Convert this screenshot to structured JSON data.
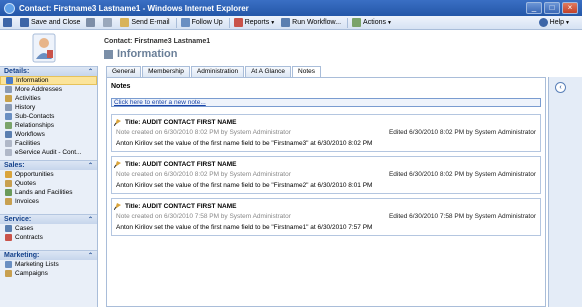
{
  "window": {
    "title": "Contact: Firstname3 Lastname1 - Windows Internet Explorer",
    "buttons": [
      "_",
      "□",
      "×"
    ]
  },
  "toolbar": {
    "save_and_close": "Save and Close",
    "send_email": "Send E-mail",
    "follow_up": "Follow Up",
    "reports": "Reports",
    "run_workflow": "Run Workflow...",
    "actions": "Actions",
    "help": "Help"
  },
  "header": {
    "entity": "Contact: Firstname3 Lastname1",
    "form_title": "Information"
  },
  "nav": {
    "details": {
      "title": "Details:",
      "items": [
        {
          "label": "Information",
          "icon": "information-icon",
          "color": "#4a7cc9"
        },
        {
          "label": "More Addresses",
          "icon": "addresses-icon",
          "color": "#8a9bb5"
        },
        {
          "label": "Activities",
          "icon": "activities-icon",
          "color": "#c9a24a"
        },
        {
          "label": "History",
          "icon": "history-icon",
          "color": "#8a9bb5"
        },
        {
          "label": "Sub-Contacts",
          "icon": "contacts-icon",
          "color": "#6a8fc2"
        },
        {
          "label": "Relationships",
          "icon": "relationships-icon",
          "color": "#7aa36a"
        },
        {
          "label": "Workflows",
          "icon": "workflow-icon",
          "color": "#5b7fb0"
        },
        {
          "label": "Facilities",
          "icon": "facilities-icon",
          "color": "#b0b8c8"
        },
        {
          "label": "eService Audit - Cont...",
          "icon": "audit-icon",
          "color": "#b0b8c8"
        }
      ]
    },
    "sales": {
      "title": "Sales:",
      "items": [
        {
          "label": "Opportunities",
          "icon": "opportunities-icon",
          "color": "#d9a43c"
        },
        {
          "label": "Quotes",
          "icon": "quotes-icon",
          "color": "#c8a050"
        },
        {
          "label": "Lands and Facilities",
          "icon": "lands-icon",
          "color": "#6a9a5a"
        },
        {
          "label": "Invoices",
          "icon": "invoices-icon",
          "color": "#c8a050"
        }
      ]
    },
    "service": {
      "title": "Service:",
      "items": [
        {
          "label": "Cases",
          "icon": "cases-icon",
          "color": "#5b7fb0"
        },
        {
          "label": "Contracts",
          "icon": "contracts-icon",
          "color": "#c9534a"
        }
      ]
    },
    "marketing": {
      "title": "Marketing:",
      "items": [
        {
          "label": "Marketing Lists",
          "icon": "marketing-lists-icon",
          "color": "#6a8fc2"
        },
        {
          "label": "Campaigns",
          "icon": "campaigns-icon",
          "color": "#c8a050"
        }
      ]
    }
  },
  "tabs": [
    "General",
    "Membership",
    "Administration",
    "At A Glance",
    "Notes"
  ],
  "notes": {
    "heading": "Notes",
    "new_note_link": "Click here to enter a new note...",
    "items": [
      {
        "title": "Title: AUDIT CONTACT FIRST NAME",
        "meta": "Note created on 6/30/2010 8:02 PM by System Administrator",
        "edited": "Edited 6/30/2010 8:02 PM by System Administrator",
        "body": "Anton Kirilov set the value of the first name field to be \"Firstname3\" at 6/30/2010 8:02 PM"
      },
      {
        "title": "Title: AUDIT CONTACT FIRST NAME",
        "meta": "Note created on 6/30/2010 8:02 PM by System Administrator",
        "edited": "Edited 6/30/2010 8:02 PM by System Administrator",
        "body": "Anton Kirilov set the value of the first name field to be \"Firstname2\" at 6/30/2010 8:01 PM"
      },
      {
        "title": "Title: AUDIT CONTACT FIRST NAME",
        "meta": "Note created on 6/30/2010 7:58 PM by System Administrator",
        "edited": "Edited 6/30/2010 7:58 PM by System Administrator",
        "body": "Anton Kirilov set the value of the first name field to be \"Firstname1\" at 6/30/2010 7:57 PM"
      }
    ]
  },
  "colors": {
    "titlebar": "#2457a8",
    "accent": "#15428b",
    "active_nav": "#fbe49b"
  }
}
